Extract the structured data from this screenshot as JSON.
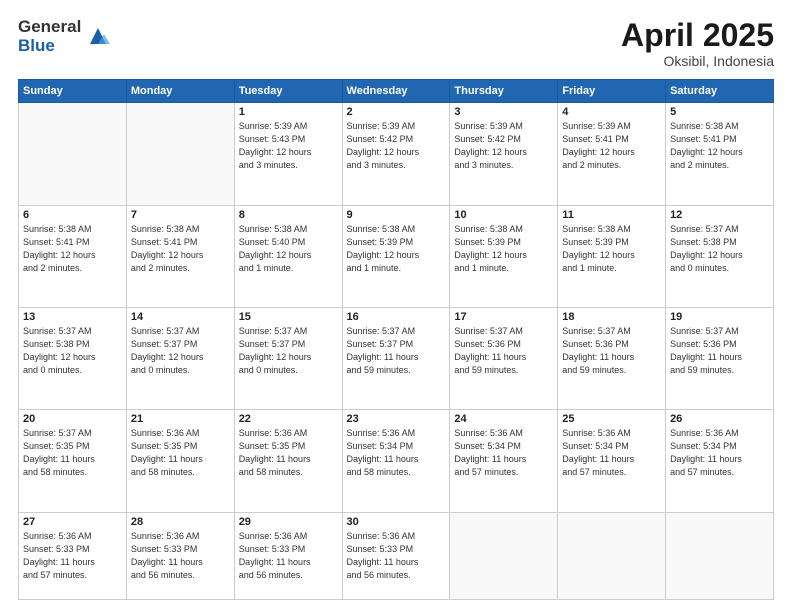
{
  "logo": {
    "general": "General",
    "blue": "Blue"
  },
  "title": "April 2025",
  "location": "Oksibil, Indonesia",
  "weekdays": [
    "Sunday",
    "Monday",
    "Tuesday",
    "Wednesday",
    "Thursday",
    "Friday",
    "Saturday"
  ],
  "weeks": [
    [
      {
        "day": "",
        "detail": ""
      },
      {
        "day": "",
        "detail": ""
      },
      {
        "day": "1",
        "detail": "Sunrise: 5:39 AM\nSunset: 5:43 PM\nDaylight: 12 hours\nand 3 minutes."
      },
      {
        "day": "2",
        "detail": "Sunrise: 5:39 AM\nSunset: 5:42 PM\nDaylight: 12 hours\nand 3 minutes."
      },
      {
        "day": "3",
        "detail": "Sunrise: 5:39 AM\nSunset: 5:42 PM\nDaylight: 12 hours\nand 3 minutes."
      },
      {
        "day": "4",
        "detail": "Sunrise: 5:39 AM\nSunset: 5:41 PM\nDaylight: 12 hours\nand 2 minutes."
      },
      {
        "day": "5",
        "detail": "Sunrise: 5:38 AM\nSunset: 5:41 PM\nDaylight: 12 hours\nand 2 minutes."
      }
    ],
    [
      {
        "day": "6",
        "detail": "Sunrise: 5:38 AM\nSunset: 5:41 PM\nDaylight: 12 hours\nand 2 minutes."
      },
      {
        "day": "7",
        "detail": "Sunrise: 5:38 AM\nSunset: 5:41 PM\nDaylight: 12 hours\nand 2 minutes."
      },
      {
        "day": "8",
        "detail": "Sunrise: 5:38 AM\nSunset: 5:40 PM\nDaylight: 12 hours\nand 1 minute."
      },
      {
        "day": "9",
        "detail": "Sunrise: 5:38 AM\nSunset: 5:39 PM\nDaylight: 12 hours\nand 1 minute."
      },
      {
        "day": "10",
        "detail": "Sunrise: 5:38 AM\nSunset: 5:39 PM\nDaylight: 12 hours\nand 1 minute."
      },
      {
        "day": "11",
        "detail": "Sunrise: 5:38 AM\nSunset: 5:39 PM\nDaylight: 12 hours\nand 1 minute."
      },
      {
        "day": "12",
        "detail": "Sunrise: 5:37 AM\nSunset: 5:38 PM\nDaylight: 12 hours\nand 0 minutes."
      }
    ],
    [
      {
        "day": "13",
        "detail": "Sunrise: 5:37 AM\nSunset: 5:38 PM\nDaylight: 12 hours\nand 0 minutes."
      },
      {
        "day": "14",
        "detail": "Sunrise: 5:37 AM\nSunset: 5:37 PM\nDaylight: 12 hours\nand 0 minutes."
      },
      {
        "day": "15",
        "detail": "Sunrise: 5:37 AM\nSunset: 5:37 PM\nDaylight: 12 hours\nand 0 minutes."
      },
      {
        "day": "16",
        "detail": "Sunrise: 5:37 AM\nSunset: 5:37 PM\nDaylight: 11 hours\nand 59 minutes."
      },
      {
        "day": "17",
        "detail": "Sunrise: 5:37 AM\nSunset: 5:36 PM\nDaylight: 11 hours\nand 59 minutes."
      },
      {
        "day": "18",
        "detail": "Sunrise: 5:37 AM\nSunset: 5:36 PM\nDaylight: 11 hours\nand 59 minutes."
      },
      {
        "day": "19",
        "detail": "Sunrise: 5:37 AM\nSunset: 5:36 PM\nDaylight: 11 hours\nand 59 minutes."
      }
    ],
    [
      {
        "day": "20",
        "detail": "Sunrise: 5:37 AM\nSunset: 5:35 PM\nDaylight: 11 hours\nand 58 minutes."
      },
      {
        "day": "21",
        "detail": "Sunrise: 5:36 AM\nSunset: 5:35 PM\nDaylight: 11 hours\nand 58 minutes."
      },
      {
        "day": "22",
        "detail": "Sunrise: 5:36 AM\nSunset: 5:35 PM\nDaylight: 11 hours\nand 58 minutes."
      },
      {
        "day": "23",
        "detail": "Sunrise: 5:36 AM\nSunset: 5:34 PM\nDaylight: 11 hours\nand 58 minutes."
      },
      {
        "day": "24",
        "detail": "Sunrise: 5:36 AM\nSunset: 5:34 PM\nDaylight: 11 hours\nand 57 minutes."
      },
      {
        "day": "25",
        "detail": "Sunrise: 5:36 AM\nSunset: 5:34 PM\nDaylight: 11 hours\nand 57 minutes."
      },
      {
        "day": "26",
        "detail": "Sunrise: 5:36 AM\nSunset: 5:34 PM\nDaylight: 11 hours\nand 57 minutes."
      }
    ],
    [
      {
        "day": "27",
        "detail": "Sunrise: 5:36 AM\nSunset: 5:33 PM\nDaylight: 11 hours\nand 57 minutes."
      },
      {
        "day": "28",
        "detail": "Sunrise: 5:36 AM\nSunset: 5:33 PM\nDaylight: 11 hours\nand 56 minutes."
      },
      {
        "day": "29",
        "detail": "Sunrise: 5:36 AM\nSunset: 5:33 PM\nDaylight: 11 hours\nand 56 minutes."
      },
      {
        "day": "30",
        "detail": "Sunrise: 5:36 AM\nSunset: 5:33 PM\nDaylight: 11 hours\nand 56 minutes."
      },
      {
        "day": "",
        "detail": ""
      },
      {
        "day": "",
        "detail": ""
      },
      {
        "day": "",
        "detail": ""
      }
    ]
  ]
}
